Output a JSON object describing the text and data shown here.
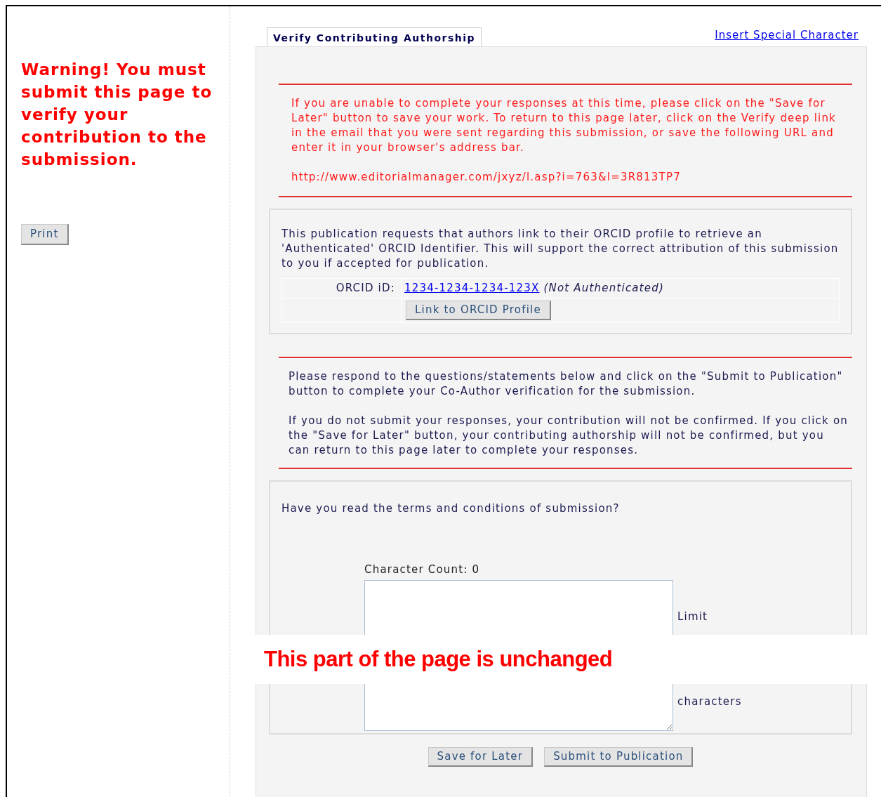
{
  "sidebar": {
    "warning": "Warning! You must submit this page to verify your contribution to the submission.",
    "print_button": "Print"
  },
  "tab": {
    "label": "Verify Contributing Authorship",
    "selected": true
  },
  "insert_link": "Insert Special Character",
  "notice": {
    "text": "If you are unable to complete your responses at this time, please click on the \"Save for Later\" button to save your work. To return to this page later, click on the Verify deep link in the email that you were sent regarding this submission, or save the following URL and enter it in your browser's address bar.",
    "url": "http://www.editorialmanager.com/jxyz/l.asp?i=763&l=3R813TP7"
  },
  "orcid": {
    "intro": "This publication requests that authors link to their ORCID profile to retrieve an 'Authenticated' ORCID Identifier. This will support the correct attribution of this submission to you if accepted for publication.",
    "label": "ORCID iD:",
    "id": "1234-1234-1234-123X",
    "status": "(Not Authenticated)",
    "button": "Link to ORCID Profile"
  },
  "instructions": [
    "Please respond to the questions/statements below and click on the \"Submit to Publication\" button to complete your Co-Author verification for the submission.",
    "If you do not submit your responses, your contribution will not be confirmed. If you click on the \"Save for Later\" button, your contributing authorship will not be confirmed, but you can return to this page later to complete your responses."
  ],
  "question": {
    "text": "Have you read the terms and conditions of submission?",
    "char_count": "Character Count: 0",
    "limit_top": "Limit",
    "limit_bottom": "characters"
  },
  "buttons": [
    "Save for Later",
    "Submit to Publication"
  ],
  "overlay_note": "This part of the page is unchanged"
}
